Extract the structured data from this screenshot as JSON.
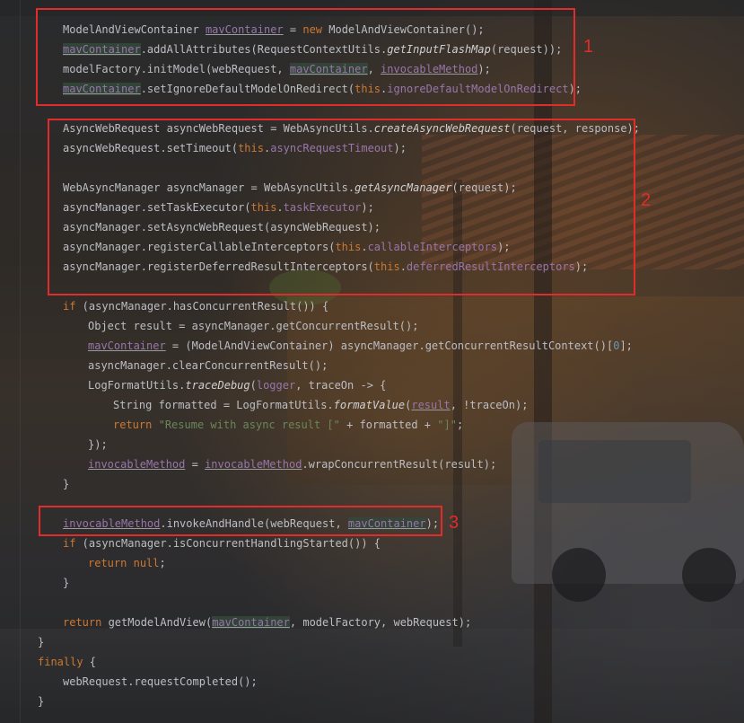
{
  "annotations": {
    "box1_label": "1",
    "box2_label": "2",
    "box3_label": "3"
  },
  "colors": {
    "keyword": "#cc7832",
    "field": "#9876aa",
    "string": "#6a8759",
    "number": "#6897bb",
    "plain": "#bcbec4",
    "annotation_red": "#e22b2b"
  },
  "code": {
    "l01": {
      "a": "ModelAndViewContainer ",
      "b": "mavContainer",
      "c": " = ",
      "d": "new",
      "e": " ModelAndViewContainer();"
    },
    "l02": {
      "a": "mavContainer",
      "b": ".addAllAttributes(RequestContextUtils.",
      "c": "getInputFlashMap",
      "d": "(request));"
    },
    "l03": {
      "a": "modelFactory.initModel(webRequest, ",
      "b": "mavContainer",
      "c": ", ",
      "d": "invocableMethod",
      "e": ");"
    },
    "l04": {
      "a": "mavContainer",
      "b": ".setIgnoreDefaultModelOnRedirect(",
      "c": "this",
      "d": ".",
      "e": "ignoreDefaultModelOnRedirect",
      "f": ");"
    },
    "l05": {
      "a": "AsyncWebRequest asyncWebRequest = WebAsyncUtils.",
      "b": "createAsyncWebRequest",
      "c": "(request, response);"
    },
    "l06": {
      "a": "asyncWebRequest.setTimeout(",
      "b": "this",
      "c": ".",
      "d": "asyncRequestTimeout",
      "e": ");"
    },
    "l07": {
      "a": "WebAsyncManager asyncManager = WebAsyncUtils.",
      "b": "getAsyncManager",
      "c": "(request);"
    },
    "l08": {
      "a": "asyncManager.setTaskExecutor(",
      "b": "this",
      "c": ".",
      "d": "taskExecutor",
      "e": ");"
    },
    "l09": {
      "a": "asyncManager.setAsyncWebRequest(asyncWebRequest);"
    },
    "l10": {
      "a": "asyncManager.registerCallableInterceptors(",
      "b": "this",
      "c": ".",
      "d": "callableInterceptors",
      "e": ");"
    },
    "l11": {
      "a": "asyncManager.registerDeferredResultInterceptors(",
      "b": "this",
      "c": ".",
      "d": "deferredResultInterceptors",
      "e": ");"
    },
    "l12": {
      "a": "if",
      "b": " (asyncManager.hasConcurrentResult()) {"
    },
    "l13": {
      "a": "Object result = asyncManager.getConcurrentResult();"
    },
    "l14": {
      "a": "mavContainer",
      "b": " = (ModelAndViewContainer) asyncManager.getConcurrentResultContext()[",
      "c": "0",
      "d": "];"
    },
    "l15": {
      "a": "asyncManager.clearConcurrentResult();"
    },
    "l16": {
      "a": "LogFormatUtils.",
      "b": "traceDebug",
      "c": "(",
      "d": "logger",
      "e": ", traceOn -> {"
    },
    "l17": {
      "a": "String formatted = LogFormatUtils.",
      "b": "formatValue",
      "c": "(",
      "d": "result",
      "e": ", !traceOn);"
    },
    "l18": {
      "a": "return",
      "b": " ",
      "c": "\"Resume with async result [\"",
      "d": " + formatted + ",
      "e": "\"]\"",
      "f": ";"
    },
    "l19": {
      "a": "});"
    },
    "l20": {
      "a": "invocableMethod",
      "b": " = ",
      "c": "invocableMethod",
      "d": ".wrapConcurrentResult(result);"
    },
    "l21": {
      "a": "}"
    },
    "l22": {
      "a": "invocableMethod",
      "b": ".invokeAndHandle(webRequest, ",
      "c": "mavContainer",
      "d": ");"
    },
    "l23": {
      "a": "if",
      "b": " (asyncManager.isConcurrentHandlingStarted()) {"
    },
    "l24": {
      "a": "return",
      "b": " ",
      "c": "null",
      "d": ";"
    },
    "l25": {
      "a": "}"
    },
    "l26": {
      "a": "return",
      "b": " getModelAndView(",
      "c": "mavContainer",
      "d": ", modelFactory, webRequest);"
    },
    "l27": {
      "a": "}"
    },
    "l28": {
      "a": "finally",
      "b": " {"
    },
    "l29": {
      "a": "webRequest.requestCompleted();"
    },
    "l30": {
      "a": "}"
    }
  }
}
